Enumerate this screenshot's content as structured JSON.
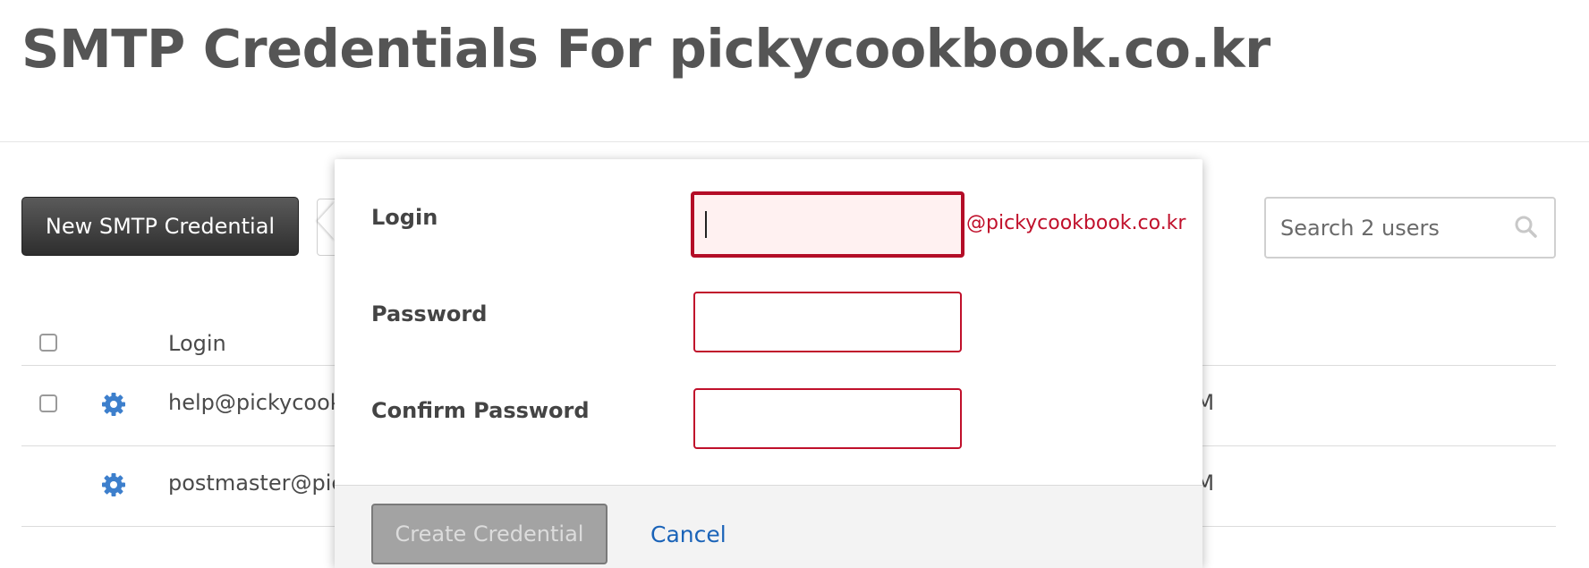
{
  "page": {
    "title": "SMTP Credentials For pickycookbook.co.kr"
  },
  "toolbar": {
    "new_button_label": "New SMTP Credential",
    "search_placeholder": "Search 2 users"
  },
  "table": {
    "columns": [
      "Login"
    ],
    "rows": [
      {
        "login": "help@pickycookb",
        "time_suffix": "AM"
      },
      {
        "login": "postmaster@pick",
        "time_suffix": "AM"
      }
    ]
  },
  "popover": {
    "fields": [
      {
        "label": "Login",
        "value": "",
        "suffix": "@pickycookbook.co.kr"
      },
      {
        "label": "Password",
        "value": ""
      },
      {
        "label": "Confirm Password",
        "value": ""
      }
    ],
    "create_button_label": "Create Credential",
    "cancel_label": "Cancel"
  },
  "colors": {
    "error_red": "#c0102b",
    "link_blue": "#1a63b8",
    "gear_blue": "#3d7fcc",
    "primary_button": "#3a3a3a"
  },
  "icons": [
    "search-icon",
    "gear-icon"
  ]
}
